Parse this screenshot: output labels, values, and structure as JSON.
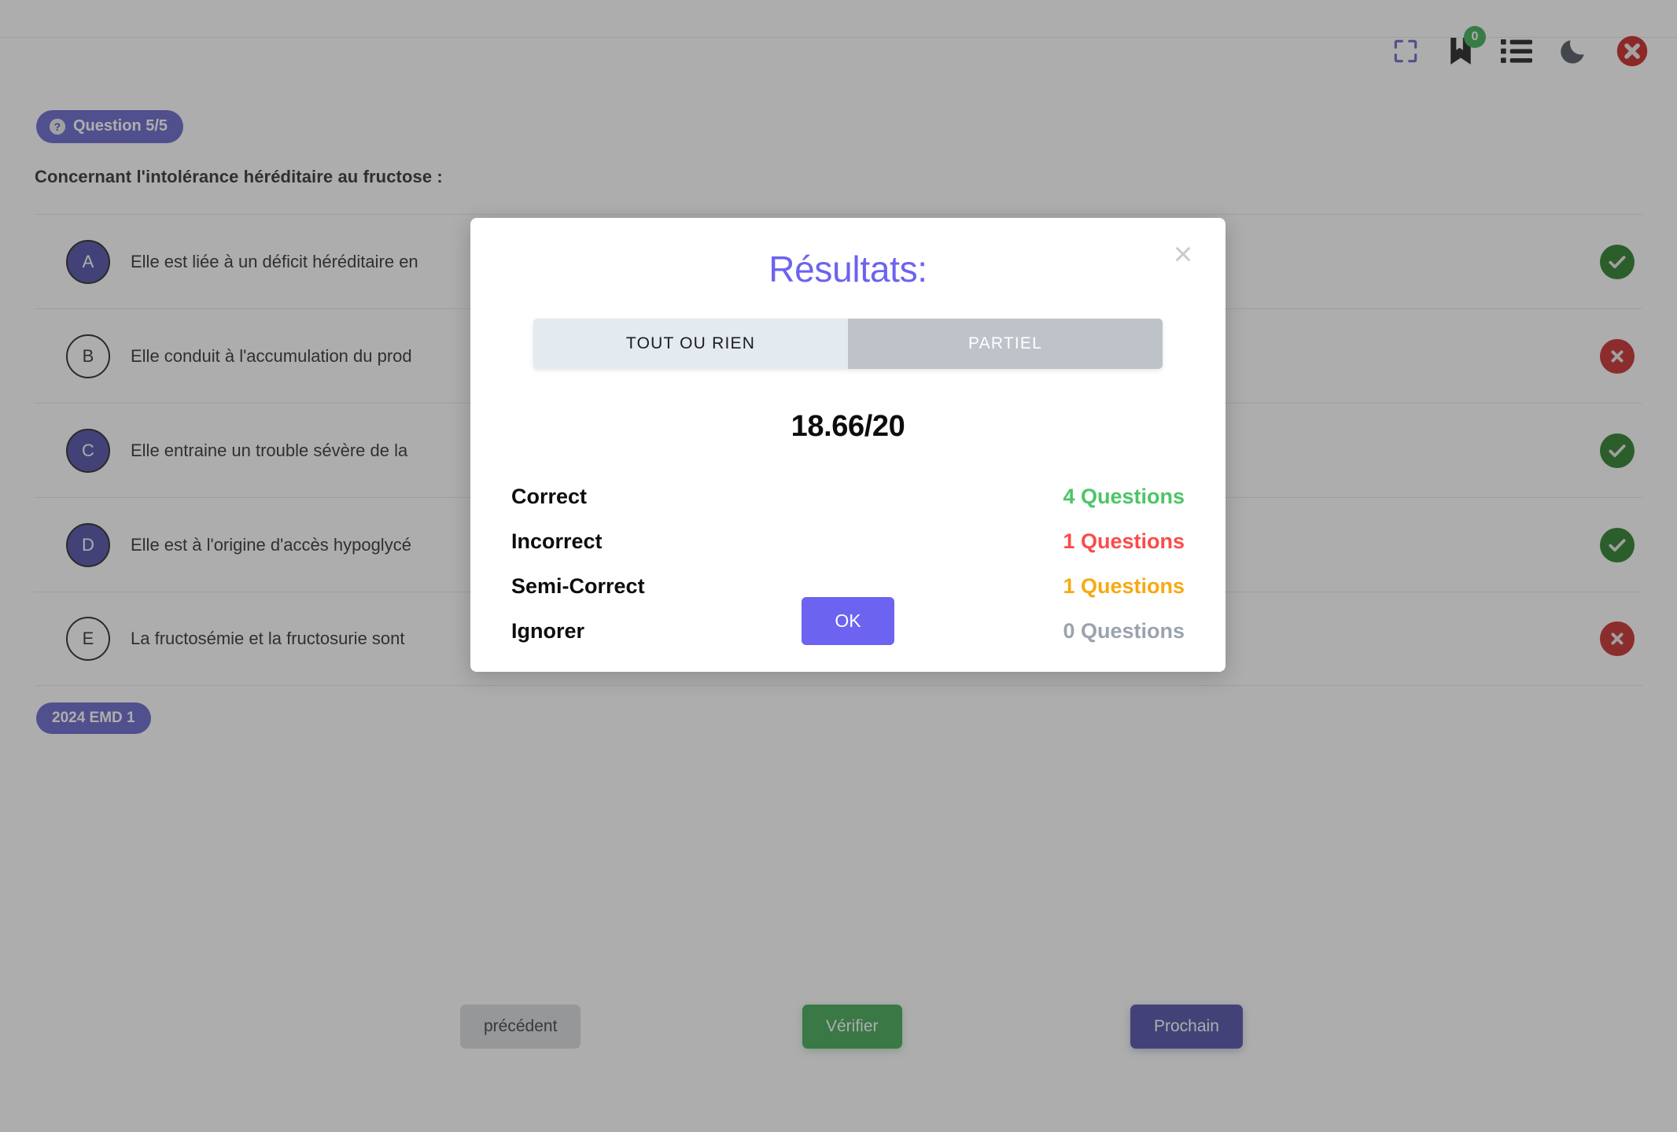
{
  "toolbar": {
    "icons": [
      {
        "name": "fullscreen-icon",
        "label": "Plein écran"
      },
      {
        "name": "bookmark-icon",
        "label": "Favoris",
        "badge": "0"
      },
      {
        "name": "list-icon",
        "label": "Liste"
      },
      {
        "name": "moon-icon",
        "label": "Mode sombre"
      },
      {
        "name": "close-icon",
        "label": "Fermer"
      }
    ]
  },
  "quiz": {
    "question_badge": "Question 5/5",
    "question_text": "Concernant l'intolérance héréditaire au fructose :",
    "source_tag": "2024 EMD 1",
    "options": [
      {
        "letter": "A",
        "text": "Elle est liée à un déficit héréditaire en",
        "selected": true,
        "status": "correct"
      },
      {
        "letter": "B",
        "text": "Elle conduit à l'accumulation du prod",
        "selected": false,
        "status": "wrong"
      },
      {
        "letter": "C",
        "text": "Elle entraine un trouble sévère de la",
        "selected": true,
        "status": "correct"
      },
      {
        "letter": "D",
        "text": "Elle est à l'origine d'accès hypoglycé",
        "selected": true,
        "status": "correct"
      },
      {
        "letter": "E",
        "text": "La fructosémie et la fructosurie sont",
        "selected": false,
        "status": "wrong"
      }
    ]
  },
  "footer": {
    "previous": "précédent",
    "check": "Vérifier",
    "next": "Prochain"
  },
  "modal": {
    "title": "Résultats:",
    "close_label": "×",
    "tabs": [
      {
        "label": "TOUT OU RIEN",
        "active": false
      },
      {
        "label": "PARTIEL",
        "active": true
      }
    ],
    "score": "18.66/20",
    "stats": [
      {
        "label": "Correct",
        "value": "4 Questions",
        "color": "#4cc566"
      },
      {
        "label": "Incorrect",
        "value": "1 Questions",
        "color": "#fb4b4b"
      },
      {
        "label": "Semi-Correct",
        "value": "1 Questions",
        "color": "#f7a912"
      },
      {
        "label": "Ignorer",
        "value": "0 Questions",
        "color": "#9aa3ad"
      }
    ],
    "ok_label": "OK"
  }
}
